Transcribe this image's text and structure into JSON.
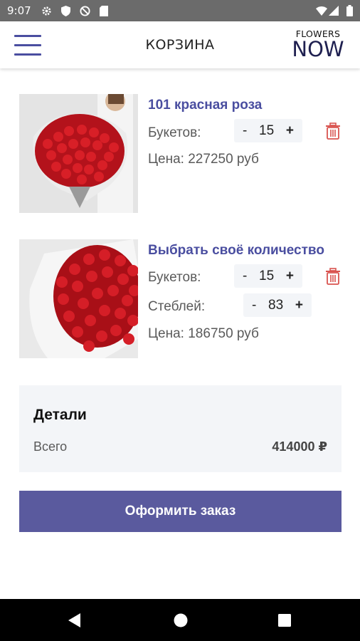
{
  "status_bar": {
    "time": "9:07",
    "icons": [
      "settings-icon",
      "shield-icon",
      "no-disturb-icon",
      "sd-card-icon",
      "wifi-icon",
      "signal-icon",
      "battery-icon"
    ]
  },
  "app_bar": {
    "title": "КОРЗИНА",
    "logo_top": "FLOWERS",
    "logo_bottom": "NOW"
  },
  "items": [
    {
      "name": "101 красная роза",
      "bouquets_label": "Букетов:",
      "bouquets_minus": "-",
      "bouquets_qty": "15",
      "bouquets_plus": "+",
      "price_label": "Цена: 227250 руб"
    },
    {
      "name": "Выбрать своё количество",
      "bouquets_label": "Букетов:",
      "bouquets_minus": "-",
      "bouquets_qty": "15",
      "bouquets_plus": "+",
      "stems_label": "Стеблей:",
      "stems_minus": "-",
      "stems_qty": "83",
      "stems_plus": "+",
      "price_label": "Цена: 186750 руб"
    }
  ],
  "details": {
    "title": "Детали",
    "total_label": "Всего",
    "total_value": "414000 ₽"
  },
  "order_button": "Оформить заказ",
  "colors": {
    "accent": "#4a4ea0",
    "button": "#5a5a9e",
    "trash": "#d9534f",
    "panel": "#f3f5f8"
  }
}
